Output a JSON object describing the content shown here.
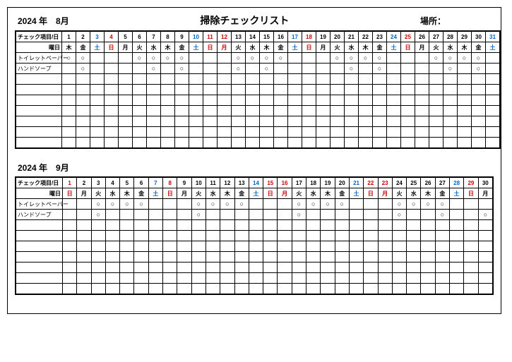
{
  "title": "掃除チェックリスト",
  "location_label": "場所：",
  "header_item_day": "チェック項目/日",
  "header_weekday": "曜日",
  "months": [
    {
      "year": "2024 年",
      "month": "8月",
      "days": [
        {
          "n": "1",
          "w": "木",
          "c": ""
        },
        {
          "n": "2",
          "w": "金",
          "c": ""
        },
        {
          "n": "3",
          "w": "土",
          "c": "blue"
        },
        {
          "n": "4",
          "w": "日",
          "c": "red"
        },
        {
          "n": "5",
          "w": "月",
          "c": ""
        },
        {
          "n": "6",
          "w": "火",
          "c": ""
        },
        {
          "n": "7",
          "w": "水",
          "c": ""
        },
        {
          "n": "8",
          "w": "木",
          "c": ""
        },
        {
          "n": "9",
          "w": "金",
          "c": ""
        },
        {
          "n": "10",
          "w": "土",
          "c": "blue"
        },
        {
          "n": "11",
          "w": "日",
          "c": "red"
        },
        {
          "n": "12",
          "w": "月",
          "c": "red"
        },
        {
          "n": "13",
          "w": "火",
          "c": ""
        },
        {
          "n": "14",
          "w": "水",
          "c": ""
        },
        {
          "n": "15",
          "w": "木",
          "c": ""
        },
        {
          "n": "16",
          "w": "金",
          "c": ""
        },
        {
          "n": "17",
          "w": "土",
          "c": "blue"
        },
        {
          "n": "18",
          "w": "日",
          "c": "red"
        },
        {
          "n": "19",
          "w": "月",
          "c": ""
        },
        {
          "n": "20",
          "w": "火",
          "c": ""
        },
        {
          "n": "21",
          "w": "水",
          "c": ""
        },
        {
          "n": "22",
          "w": "木",
          "c": ""
        },
        {
          "n": "23",
          "w": "金",
          "c": ""
        },
        {
          "n": "24",
          "w": "土",
          "c": "blue"
        },
        {
          "n": "25",
          "w": "日",
          "c": "red"
        },
        {
          "n": "26",
          "w": "月",
          "c": ""
        },
        {
          "n": "27",
          "w": "火",
          "c": ""
        },
        {
          "n": "28",
          "w": "水",
          "c": ""
        },
        {
          "n": "29",
          "w": "木",
          "c": ""
        },
        {
          "n": "30",
          "w": "金",
          "c": ""
        },
        {
          "n": "31",
          "w": "土",
          "c": "blue"
        }
      ],
      "rows": [
        {
          "label": "トイレットペーパー",
          "marks": [
            "○",
            "○",
            "",
            "",
            "",
            "○",
            "○",
            "○",
            "○",
            "",
            "",
            "",
            "○",
            "○",
            "○",
            "○",
            "",
            "",
            "",
            "○",
            "○",
            "○",
            "○",
            "",
            "",
            "",
            "○",
            "○",
            "○",
            "○",
            ""
          ]
        },
        {
          "label": "ハンドソープ",
          "marks": [
            "",
            "○",
            "",
            "",
            "",
            "",
            "○",
            "",
            "○",
            "",
            "",
            "",
            "○",
            "",
            "○",
            "",
            "",
            "",
            "",
            "",
            "○",
            "",
            "○",
            "",
            "",
            "",
            "",
            "○",
            "",
            "○",
            ""
          ]
        },
        {
          "label": "",
          "marks": []
        },
        {
          "label": "",
          "marks": []
        },
        {
          "label": "",
          "marks": []
        },
        {
          "label": "",
          "marks": []
        },
        {
          "label": "",
          "marks": []
        },
        {
          "label": "",
          "marks": []
        },
        {
          "label": "",
          "marks": []
        }
      ]
    },
    {
      "year": "2024 年",
      "month": "9月",
      "days": [
        {
          "n": "1",
          "w": "日",
          "c": "red"
        },
        {
          "n": "2",
          "w": "月",
          "c": ""
        },
        {
          "n": "3",
          "w": "火",
          "c": ""
        },
        {
          "n": "4",
          "w": "水",
          "c": ""
        },
        {
          "n": "5",
          "w": "木",
          "c": ""
        },
        {
          "n": "6",
          "w": "金",
          "c": ""
        },
        {
          "n": "7",
          "w": "土",
          "c": "blue"
        },
        {
          "n": "8",
          "w": "日",
          "c": "red"
        },
        {
          "n": "9",
          "w": "月",
          "c": ""
        },
        {
          "n": "10",
          "w": "火",
          "c": ""
        },
        {
          "n": "11",
          "w": "水",
          "c": ""
        },
        {
          "n": "12",
          "w": "木",
          "c": ""
        },
        {
          "n": "13",
          "w": "金",
          "c": ""
        },
        {
          "n": "14",
          "w": "土",
          "c": "blue"
        },
        {
          "n": "15",
          "w": "日",
          "c": "red"
        },
        {
          "n": "16",
          "w": "月",
          "c": "red"
        },
        {
          "n": "17",
          "w": "火",
          "c": ""
        },
        {
          "n": "18",
          "w": "水",
          "c": ""
        },
        {
          "n": "19",
          "w": "木",
          "c": ""
        },
        {
          "n": "20",
          "w": "金",
          "c": ""
        },
        {
          "n": "21",
          "w": "土",
          "c": "blue"
        },
        {
          "n": "22",
          "w": "日",
          "c": "red"
        },
        {
          "n": "23",
          "w": "月",
          "c": "red"
        },
        {
          "n": "24",
          "w": "火",
          "c": ""
        },
        {
          "n": "25",
          "w": "水",
          "c": ""
        },
        {
          "n": "26",
          "w": "木",
          "c": ""
        },
        {
          "n": "27",
          "w": "金",
          "c": ""
        },
        {
          "n": "28",
          "w": "土",
          "c": "blue"
        },
        {
          "n": "29",
          "w": "日",
          "c": "red"
        },
        {
          "n": "30",
          "w": "月",
          "c": ""
        }
      ],
      "rows": [
        {
          "label": "トイレットペーパー",
          "marks": [
            "",
            "",
            "○",
            "○",
            "○",
            "○",
            "",
            "",
            "",
            "○",
            "○",
            "○",
            "○",
            "",
            "",
            "",
            "○",
            "○",
            "○",
            "○",
            "",
            "",
            "",
            "○",
            "○",
            "○",
            "○",
            "",
            "",
            ""
          ]
        },
        {
          "label": "ハンドソープ",
          "marks": [
            "",
            "",
            "○",
            "",
            "",
            "",
            "",
            "",
            "",
            "○",
            "",
            "",
            "",
            "",
            "",
            "",
            "○",
            "",
            "",
            "",
            "",
            "",
            "",
            "○",
            "",
            "",
            "○",
            "",
            "",
            "○"
          ]
        },
        {
          "label": "",
          "marks": []
        },
        {
          "label": "",
          "marks": []
        },
        {
          "label": "",
          "marks": []
        },
        {
          "label": "",
          "marks": []
        },
        {
          "label": "",
          "marks": []
        },
        {
          "label": "",
          "marks": []
        },
        {
          "label": "",
          "marks": []
        }
      ]
    }
  ]
}
